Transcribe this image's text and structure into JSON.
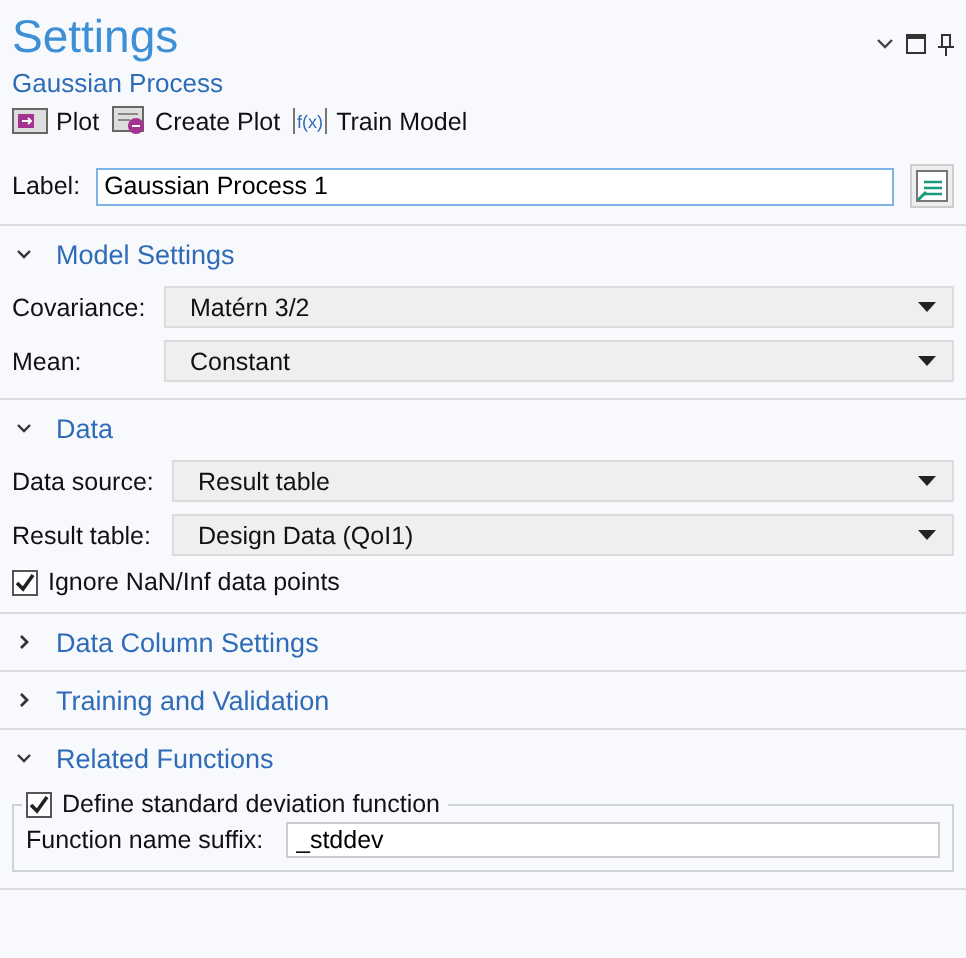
{
  "header": {
    "title": "Settings",
    "subtitle": "Gaussian Process"
  },
  "toolbar": [
    {
      "label": "Plot",
      "kind": "plot"
    },
    {
      "label": "Create Plot",
      "kind": "create"
    },
    {
      "label": "Train Model",
      "kind": "function",
      "icon_text": "f(x)"
    }
  ],
  "label_field": {
    "label": "Label:",
    "value": "Gaussian Process 1"
  },
  "sections": [
    {
      "title": "Model Settings",
      "expanded": true,
      "rows": [
        {
          "kind": "select",
          "label": "Covariance:",
          "value": "Matérn 3/2"
        },
        {
          "kind": "select",
          "label": "Mean:",
          "value": "Constant"
        }
      ]
    },
    {
      "title": "Data",
      "expanded": true,
      "rows": [
        {
          "kind": "select",
          "label": "Data source:",
          "value": "Result table"
        },
        {
          "kind": "select",
          "label": "Result table:",
          "value": "Design Data (QoI1)"
        },
        {
          "kind": "checkbox",
          "label": "Ignore NaN/Inf data points",
          "checked": true
        }
      ]
    },
    {
      "title": "Data Column Settings",
      "expanded": false
    },
    {
      "title": "Training and Validation",
      "expanded": false
    },
    {
      "title": "Related Functions",
      "expanded": true,
      "rows": [
        {
          "kind": "group",
          "label": "Define standard deviation function",
          "checked": true,
          "field_label": "Function name suffix:",
          "value": "_stddev"
        }
      ]
    }
  ]
}
